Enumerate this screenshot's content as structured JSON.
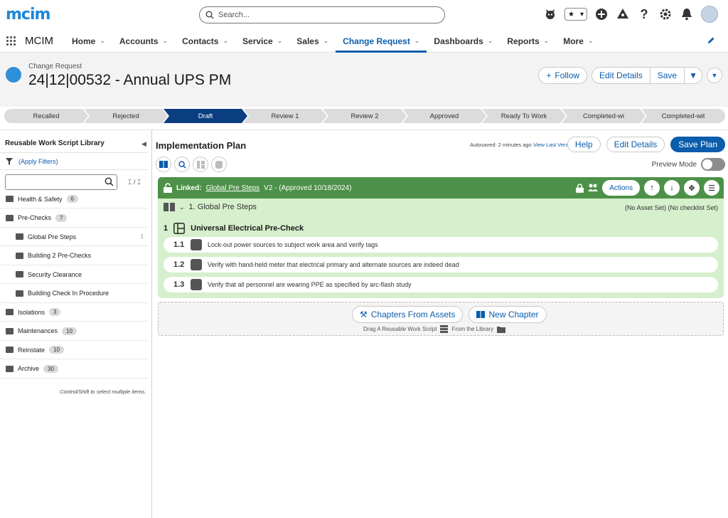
{
  "topbar": {
    "logo": "mcim",
    "search_placeholder": "Search..."
  },
  "nav": {
    "app_name": "MCIM",
    "items": [
      {
        "label": "Home"
      },
      {
        "label": "Accounts"
      },
      {
        "label": "Contacts"
      },
      {
        "label": "Service"
      },
      {
        "label": "Sales"
      },
      {
        "label": "Change Request",
        "active": true
      },
      {
        "label": "Dashboards"
      },
      {
        "label": "Reports"
      },
      {
        "label": "More"
      }
    ]
  },
  "record": {
    "object_label": "Change Request",
    "title": "24|12|00532 - Annual UPS PM",
    "follow_label": "Follow",
    "edit_details_label": "Edit Details",
    "save_label": "Save"
  },
  "path": {
    "stages": [
      "Recalled",
      "Rejected",
      "Draft",
      "Review 1",
      "Review 2",
      "Approved",
      "Ready To Work",
      "Completed-wi",
      "Completed-wit"
    ],
    "current_index": 2
  },
  "library": {
    "title": "Reusable Work Script Library",
    "apply_filters": "(Apply Filters)",
    "sort_label": "⌶ / ⌶",
    "hint": "Control/Shift to select multiple items.",
    "items": [
      {
        "label": "Health & Safety",
        "count": "6",
        "level": 0
      },
      {
        "label": "Pre-Checks",
        "count": "7",
        "level": 0
      },
      {
        "label": "Global Pre Steps",
        "count": "",
        "trail": "1",
        "level": 1
      },
      {
        "label": "Building 2 Pre-Checks",
        "count": "",
        "level": 1
      },
      {
        "label": "Security Clearance",
        "count": "",
        "level": 1
      },
      {
        "label": "Building Check In Procedure",
        "count": "",
        "level": 1
      },
      {
        "label": "Isolations",
        "count": "3",
        "level": 0
      },
      {
        "label": "Maintenances",
        "count": "10",
        "level": 0
      },
      {
        "label": "Reinstate",
        "count": "10",
        "level": 0
      },
      {
        "label": "Archive",
        "count": "30",
        "level": 0
      }
    ]
  },
  "plan": {
    "title": "Implementation Plan",
    "autosave_text": "Autosaved: 2 minutes ago",
    "view_last_version": "View Last Version",
    "help_label": "Help",
    "edit_details_label": "Edit Details",
    "save_plan_label": "Save Plan",
    "preview_mode_label": "Preview Mode",
    "linked_prefix": "Linked:",
    "linked_name": "Global Pre Steps",
    "linked_suffix": "V2 - (Approved 10/18/2024)",
    "actions_label": "Actions",
    "chapter_title": "1. Global Pre Steps",
    "chapter_meta": "(No Asset Set) (No checklist Set)",
    "step_number": "1",
    "step_title": "Universal Electrical Pre-Check",
    "substeps": [
      {
        "num": "1.1",
        "text": "Lock-out power sources to subject work area and verify tags"
      },
      {
        "num": "1.2",
        "text": "Verify with hand-held meter that electrical primary and alternate sources are indeed dead"
      },
      {
        "num": "1.3",
        "text": "Verify that all personnel are wearing PPE as specified by arc-flash study"
      }
    ],
    "chapters_from_assets": "Chapters From Assets",
    "new_chapter": "New Chapter",
    "drag_hint_a": "Drag A Reusable Work Script",
    "drag_hint_b": "From the Library"
  },
  "colors": {
    "brand": "#0b5cab",
    "linked_bar": "#4d9148",
    "linked_panel": "#d6efcc",
    "path_current": "#0b3e80"
  }
}
